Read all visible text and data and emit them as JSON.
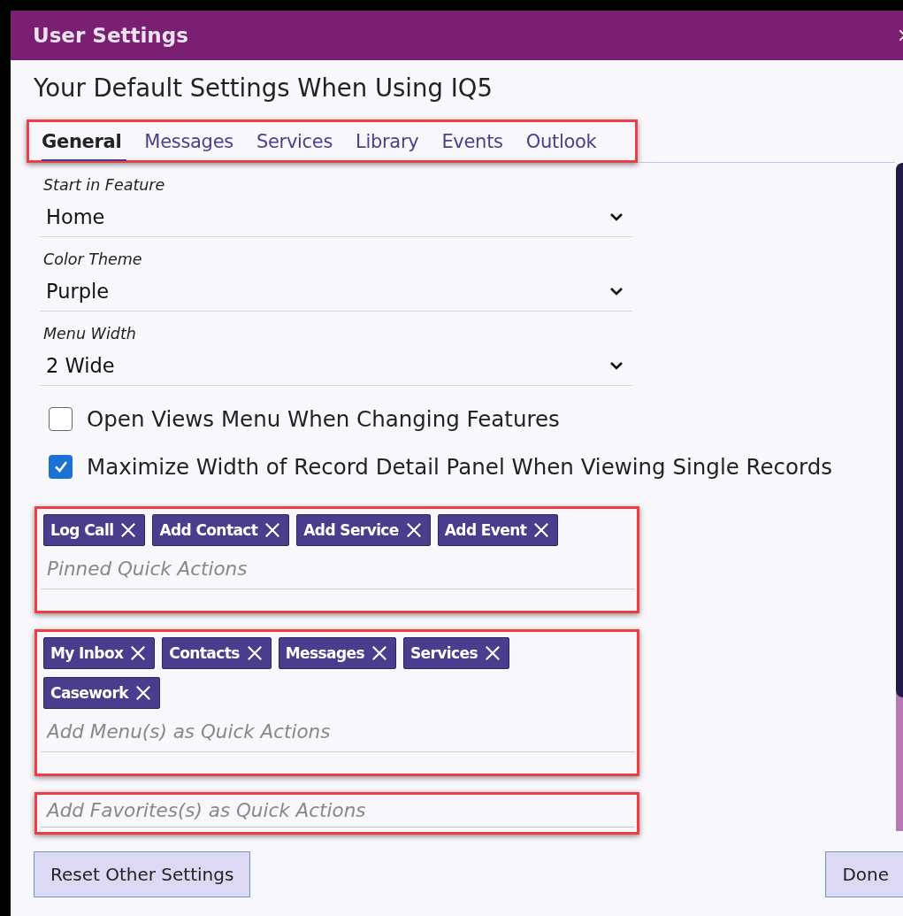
{
  "window": {
    "title": "User Settings"
  },
  "heading": "Your Default Settings When Using IQ5",
  "tabs_highlighted": true,
  "tabs": [
    {
      "label": "General",
      "selected": true
    },
    {
      "label": "Messages",
      "selected": false
    },
    {
      "label": "Services",
      "selected": false
    },
    {
      "label": "Library",
      "selected": false
    },
    {
      "label": "Events",
      "selected": false
    },
    {
      "label": "Outlook",
      "selected": false
    }
  ],
  "fields": [
    {
      "label": "Start in Feature",
      "value": "Home"
    },
    {
      "label": "Color Theme",
      "value": "Purple"
    },
    {
      "label": "Menu Width",
      "value": "2 Wide"
    }
  ],
  "checkboxes": [
    {
      "label": "Open Views Menu When Changing Features",
      "checked": false
    },
    {
      "label": "Maximize Width of Record Detail Panel When Viewing Single Records",
      "checked": true
    }
  ],
  "quick_action_fields": [
    {
      "chips": [
        "Log Call",
        "Add Contact",
        "Add Service",
        "Add Event"
      ],
      "placeholder": "Pinned Quick Actions",
      "highlighted": true
    },
    {
      "chips": [
        "My Inbox",
        "Contacts",
        "Messages",
        "Services",
        "Casework"
      ],
      "placeholder": "Add Menu(s) as Quick Actions",
      "highlighted": true
    },
    {
      "placeholder": "Add Favorites(s) as Quick Actions",
      "highlighted": true
    }
  ],
  "buttons": [
    {
      "label": "Reset Other Settings"
    },
    {
      "label": "Done"
    }
  ]
}
